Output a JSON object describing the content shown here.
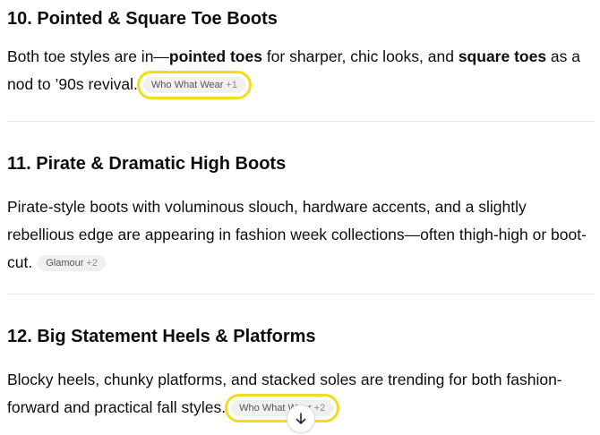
{
  "sections": [
    {
      "title": "10. Pointed & Square Toe Boots",
      "text_1": "Both toe styles are in—",
      "bold_1": "pointed toes",
      "text_2": " for sharper, chic looks, and ",
      "bold_2": "square toes",
      "text_3": " as a nod to ’90s revival.",
      "citation": {
        "source": "Who What Wear",
        "count": "+1"
      }
    },
    {
      "title": "11. Pirate & Dramatic High Boots",
      "text": "Pirate-style boots with voluminous slouch, hardware accents, and a slightly rebellious edge are appearing in fashion week collections—often thigh-high or boot-cut.",
      "citation": {
        "source": "Glamour",
        "count": "+2"
      }
    },
    {
      "title": "12. Big Statement Heels & Platforms",
      "text": "Blocky heels, chunky platforms, and stacked soles are trending for both fashion-forward and practical fall styles.",
      "citation": {
        "source": "Who What Wear",
        "count": "+2"
      }
    }
  ],
  "scroll_button": {
    "icon": "arrow-down-icon"
  },
  "colors": {
    "highlight": "#f2dc1e",
    "chip_bg": "#f0f0f0",
    "divider": "#e4e4e4"
  }
}
